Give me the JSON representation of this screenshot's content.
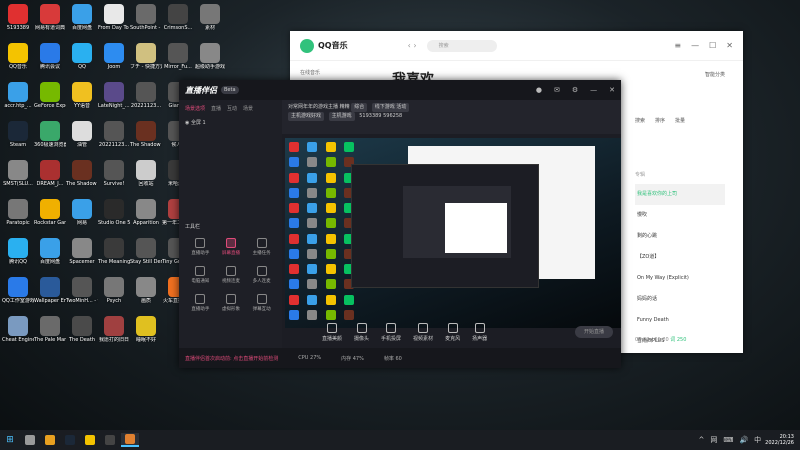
{
  "desktop": {
    "icons": [
      {
        "label": "5193389",
        "color": "#e03030"
      },
      {
        "label": "网易有道词典",
        "color": "#d83a3a"
      },
      {
        "label": "百度网盘",
        "color": "#3aa0e8"
      },
      {
        "label": "From Day To Day...",
        "color": "#e8e8e8"
      },
      {
        "label": "SouthPoint - 快捷方式",
        "color": "#6a6a6a"
      },
      {
        "label": "CrimsonS...",
        "color": "#444"
      },
      {
        "label": "素材",
        "color": "#777"
      },
      {
        "label": "QQ音乐",
        "color": "#f4c300"
      },
      {
        "label": "腾讯会议",
        "color": "#2a7ae8"
      },
      {
        "label": "QQ",
        "color": "#2ab0f0"
      },
      {
        "label": "Joom",
        "color": "#2d8cf0"
      },
      {
        "label": "フチ - 快捷方式",
        "color": "#d0c080"
      },
      {
        "label": "Mirror_Fu...",
        "color": "#555"
      },
      {
        "label": "超级助手游戏",
        "color": "#888"
      },
      {
        "label": "accr.htp_...",
        "color": "#3aa0e8"
      },
      {
        "label": "GeForce Experience",
        "color": "#76b900"
      },
      {
        "label": "YY语音",
        "color": "#f0c020"
      },
      {
        "label": "LateNight_... 快捷方式",
        "color": "#5a4a8a"
      },
      {
        "label": "20221123...",
        "color": "#555"
      },
      {
        "label": "Gianc...",
        "color": "#555"
      },
      {
        "label": "QQ游戏",
        "color": "#2a7ae8"
      },
      {
        "label": "Steam",
        "color": "#1b2838"
      },
      {
        "label": "360极速浏览器",
        "color": "#3aa86a"
      },
      {
        "label": "油管",
        "color": "#ddd"
      },
      {
        "label": "20221123...",
        "color": "#555"
      },
      {
        "label": "The Shadow Over Rock...",
        "color": "#6a3020"
      },
      {
        "label": "候人3",
        "color": "#555"
      },
      {
        "label": "OBS Studio",
        "color": "#302e31"
      },
      {
        "label": "SMST(SLU...",
        "color": "#888"
      },
      {
        "label": "DREAM_J...",
        "color": "#aa3030"
      },
      {
        "label": "The Shadow Over Rock...",
        "color": "#6a3020"
      },
      {
        "label": "Survive!",
        "color": "#555"
      },
      {
        "label": "回收站",
        "color": "#ccc"
      },
      {
        "label": "米哈游戏",
        "color": "#3a3a3a"
      },
      {
        "label": "ProDriver",
        "color": "#c03030"
      },
      {
        "label": "Paratopic",
        "color": "#777"
      },
      {
        "label": "Rockstar Games...",
        "color": "#f0b000"
      },
      {
        "label": "网易",
        "color": "#3aa0e8"
      },
      {
        "label": "Studio One 5",
        "color": "#2a2a2a"
      },
      {
        "label": "Apparition",
        "color": "#888"
      },
      {
        "label": "第一年二周年快捷方式",
        "color": "#b04040"
      },
      {
        "label": "Poppy Play...",
        "color": "#555"
      },
      {
        "label": "腾讯QQ",
        "color": "#2ab0f0"
      },
      {
        "label": "百度网盘",
        "color": "#3aa0e8"
      },
      {
        "label": "Spacemer",
        "color": "#888"
      },
      {
        "label": "The Meaning...",
        "color": "#3a3a3a"
      },
      {
        "label": "Stay Still Demo",
        "color": "#555"
      },
      {
        "label": "Tiny Grimm...",
        "color": "#555"
      },
      {
        "label": "微信",
        "color": "#07c160"
      },
      {
        "label": "QQ工作室游戏",
        "color": "#2a7ae8"
      },
      {
        "label": "Wallpaper Engine:...",
        "color": "#2a5a9a"
      },
      {
        "label": "TwoMinH... - 快捷方式",
        "color": "#555"
      },
      {
        "label": "Psych",
        "color": "#777"
      },
      {
        "label": "画质",
        "color": "#888"
      },
      {
        "label": "火车直播中心",
        "color": "#f07020"
      },
      {
        "label": "QQ游戏",
        "color": "#2a7ae8"
      },
      {
        "label": "Cheat Engine",
        "color": "#7a9ac0"
      },
      {
        "label": "The Pale Man - 快捷方式",
        "color": "#6a6a6a"
      },
      {
        "label": "The Death",
        "color": "#4a4a4a"
      },
      {
        "label": "我愿打的旧日",
        "color": "#a04040"
      },
      {
        "label": "睡眠不好",
        "color": "#e0c020"
      }
    ]
  },
  "qqmusic": {
    "title": "QQ音乐",
    "search_placeholder": "搜索",
    "sidebar_label": "在线音乐",
    "heading": "我喜欢",
    "smart_label": "智能分类",
    "tools": [
      "搜索",
      "排序",
      "批量"
    ],
    "list_header": "专辑",
    "songs": [
      "我是喜欢你的上司",
      "慢吹",
      "剩的心跳",
      "【ZO道】",
      "On My Way (Explicit)",
      "妈妈的话",
      "Funny Death",
      "雪雨西PLUS"
    ],
    "active_song_index": 0,
    "time": "00:32 / 01:20",
    "extra": "词 250"
  },
  "live": {
    "app_title": "直播伴侣",
    "badge": "Beta",
    "tabs": [
      "场景选项",
      "直播",
      "互动",
      "场景"
    ],
    "scene_name": "全屏 1",
    "info_line1": "对常网年年的游戏主播 精精",
    "info_tags": [
      "综合",
      "线下游戏 活动"
    ],
    "info_line2_tags": [
      "主机游戏好戏",
      "主机游戏"
    ],
    "fans": "5193389",
    "likes": "596258",
    "tools_title": "工具栏",
    "tools": [
      {
        "label": "直播助手",
        "accent": false
      },
      {
        "label": "屏幕直播",
        "accent": true
      },
      {
        "label": "主播任务",
        "accent": false
      },
      {
        "label": "电脑通知",
        "accent": false
      },
      {
        "label": "视频连麦",
        "accent": false
      },
      {
        "label": "多人连麦",
        "accent": false
      },
      {
        "label": "直播助手",
        "accent": false
      },
      {
        "label": "虚拟形象",
        "accent": false
      },
      {
        "label": "弹幕互动",
        "accent": false
      }
    ],
    "controls": [
      "直播美颜",
      "摄像头",
      "手机投屏",
      "视频素材",
      "麦克风",
      "扬声器"
    ],
    "start_button": "开始直播",
    "status_warn": "直播伴侣首次启动前: 点击直播开始前检测",
    "status_items": [
      "CPU 27%",
      "内存 47%",
      "帧率 60"
    ]
  },
  "taskbar": {
    "start": "⊞",
    "apps": [
      "search",
      "browser",
      "steam",
      "qqmusic",
      "obs",
      "live"
    ],
    "active_app_index": 5,
    "time": "20:13",
    "date": "2022/12/26",
    "tray": [
      "^",
      "网",
      "⌨",
      "🔊",
      "中"
    ]
  }
}
